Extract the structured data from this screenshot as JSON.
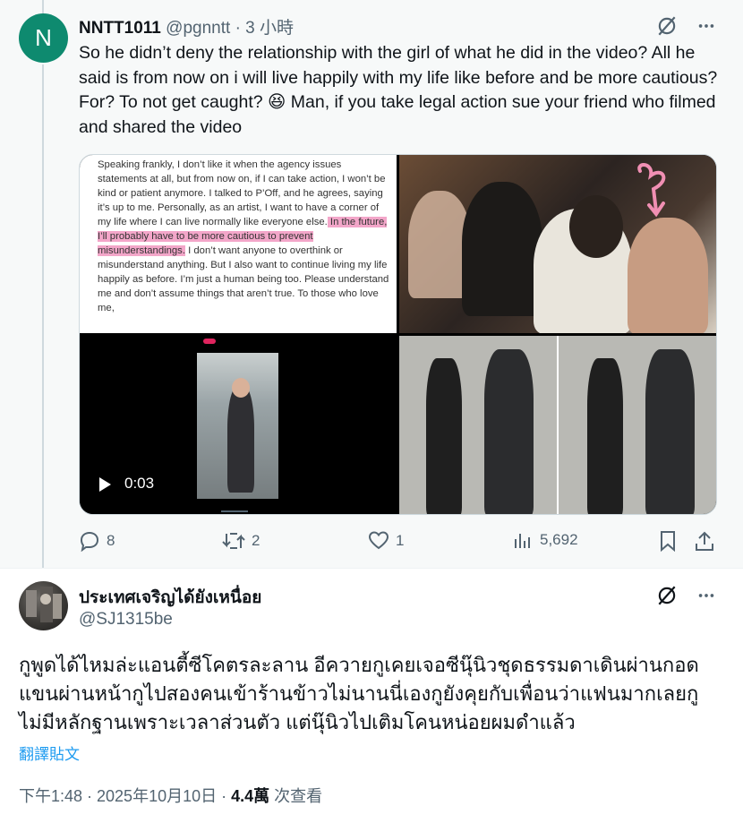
{
  "reply": {
    "avatar_letter": "N",
    "author": "NNTT1011",
    "handle": "@pgnntt",
    "separator": "·",
    "time": "3 小時",
    "text": "So he didn’t deny the relationship with the girl of what he did in the video? All he said is from now on i will live happily with my life like before and be more cautious? For? To not get caught? 😆 Man, if you take legal action sue your friend who filmed and shared the video",
    "media": {
      "statement_before": "Speaking frankly, I don’t like it when the agency issues statements at all, but from now on, if I can take action, I won’t be kind or patient anymore. I talked to P’Off, and he agrees, saying it’s up to me. Personally, as an artist, I want to have a corner of my life where I can live normally like everyone else.",
      "statement_highlight": " In the future, I’ll probably have to be more cautious to prevent misunderstandings.",
      "statement_after": " I don’t want anyone to overthink or misunderstand anything. But I also want to continue living my life happily as before. I’m just a human being too. Please understand me and don’t assume things that aren’t true. To those who love me,",
      "video_time": "0:03"
    },
    "actions": {
      "replies": "8",
      "reposts": "2",
      "likes": "1",
      "views": "5,692"
    }
  },
  "main": {
    "author": "ประเทศเจริญได้ยังเหนื่อย",
    "handle": "@SJ1315be",
    "text": "กูพูดได้ไหมล่ะแอนตี้ซีโคตรละลาน อีควายกูเคยเจอซีนุ๊นิวชุดธรรมดาเดินผ่านกอดแขนผ่านหน้ากูไปสองคนเข้าร้านข้าวไม่นานนี่เองกูยังคุยกับเพื่อนว่าแฟนมากเลยกู ไม่มีหลักฐานเพราะเวลาส่วนตัว แต่นุ๊นิวไปเติมโคนหน่อยผมดำแล้ว",
    "translate_label": "翻譯貼文",
    "timestamp": "下午1:48 · 2025年10月10日 · ",
    "views_count": "4.4萬",
    "views_label": " 次查看"
  },
  "icons": [
    "grok-icon",
    "more-icon",
    "reply-icon",
    "repost-icon",
    "like-icon",
    "views-icon",
    "bookmark-icon",
    "share-icon",
    "play-icon"
  ],
  "colors": {
    "accent": "#1d9bf0",
    "muted": "#536471",
    "avatar": "#0e8a6f",
    "highlight": "#e95d9c"
  }
}
